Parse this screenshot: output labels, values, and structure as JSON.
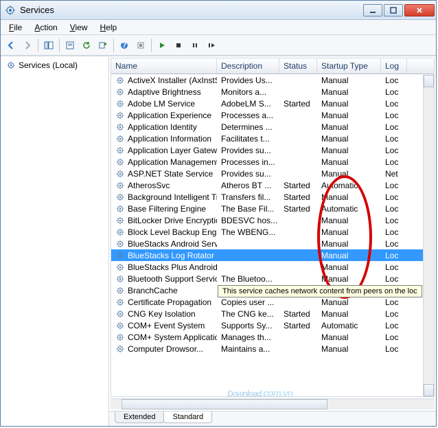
{
  "window": {
    "title": "Services"
  },
  "menus": {
    "file": "File",
    "action": "Action",
    "view": "View",
    "help": "Help"
  },
  "tree": {
    "root": "Services (Local)"
  },
  "columns": {
    "name": "Name",
    "description": "Description",
    "status": "Status",
    "startup": "Startup Type",
    "logon": "Log"
  },
  "tabs": {
    "extended": "Extended",
    "standard": "Standard"
  },
  "tooltip": "This service caches network content from peers on the loc",
  "watermark": {
    "main": "Download",
    "sub": ".com.vn"
  },
  "rows": [
    {
      "name": "ActiveX Installer (AxInstSV)",
      "desc": "Provides Us...",
      "status": "",
      "startup": "Manual",
      "log": "Loc"
    },
    {
      "name": "Adaptive Brightness",
      "desc": "Monitors a...",
      "status": "",
      "startup": "Manual",
      "log": "Loc"
    },
    {
      "name": "Adobe LM Service",
      "desc": "AdobeLM S...",
      "status": "Started",
      "startup": "Manual",
      "log": "Loc"
    },
    {
      "name": "Application Experience",
      "desc": "Processes a...",
      "status": "",
      "startup": "Manual",
      "log": "Loc"
    },
    {
      "name": "Application Identity",
      "desc": "Determines ...",
      "status": "",
      "startup": "Manual",
      "log": "Loc"
    },
    {
      "name": "Application Information",
      "desc": "Facilitates t...",
      "status": "",
      "startup": "Manual",
      "log": "Loc"
    },
    {
      "name": "Application Layer Gateway Ser...",
      "desc": "Provides su...",
      "status": "",
      "startup": "Manual",
      "log": "Loc"
    },
    {
      "name": "Application Management",
      "desc": "Processes in...",
      "status": "",
      "startup": "Manual",
      "log": "Loc"
    },
    {
      "name": "ASP.NET State Service",
      "desc": "Provides su...",
      "status": "",
      "startup": "Manual",
      "log": "Net"
    },
    {
      "name": "AtherosSvc",
      "desc": "Atheros BT ...",
      "status": "Started",
      "startup": "Automatic",
      "log": "Loc"
    },
    {
      "name": "Background Intelligent Transf...",
      "desc": "Transfers fil...",
      "status": "Started",
      "startup": "Manual",
      "log": "Loc"
    },
    {
      "name": "Base Filtering Engine",
      "desc": "The Base Fil...",
      "status": "Started",
      "startup": "Automatic",
      "log": "Loc"
    },
    {
      "name": "BitLocker Drive Encryption Ser...",
      "desc": "BDESVC hos...",
      "status": "",
      "startup": "Manual",
      "log": "Loc"
    },
    {
      "name": "Block Level Backup Engine Ser...",
      "desc": "The WBENG...",
      "status": "",
      "startup": "Manual",
      "log": "Loc"
    },
    {
      "name": "BlueStacks Android Service",
      "desc": "",
      "status": "",
      "startup": "Manual",
      "log": "Loc"
    },
    {
      "name": "BlueStacks Log Rotator Service",
      "desc": "",
      "status": "",
      "startup": "Manual",
      "log": "Loc",
      "selected": true
    },
    {
      "name": "BlueStacks Plus Android Servi...",
      "desc": "",
      "status": "",
      "startup": "Manual",
      "log": "Loc"
    },
    {
      "name": "Bluetooth Support Service",
      "desc": "The Bluetoo...",
      "status": "",
      "startup": "Manual",
      "log": "Loc"
    },
    {
      "name": "BranchCache",
      "desc": "",
      "status": "",
      "startup": "Manual",
      "log": "Loc"
    },
    {
      "name": "Certificate Propagation",
      "desc": "Copies user ...",
      "status": "",
      "startup": "Manual",
      "log": "Loc"
    },
    {
      "name": "CNG Key Isolation",
      "desc": "The CNG ke...",
      "status": "Started",
      "startup": "Manual",
      "log": "Loc"
    },
    {
      "name": "COM+ Event System",
      "desc": "Supports Sy...",
      "status": "Started",
      "startup": "Automatic",
      "log": "Loc"
    },
    {
      "name": "COM+ System Application",
      "desc": "Manages th...",
      "status": "",
      "startup": "Manual",
      "log": "Loc"
    },
    {
      "name": "Computer Drowsor...",
      "desc": "Maintains a...",
      "status": "",
      "startup": "Manual",
      "log": "Loc"
    }
  ]
}
